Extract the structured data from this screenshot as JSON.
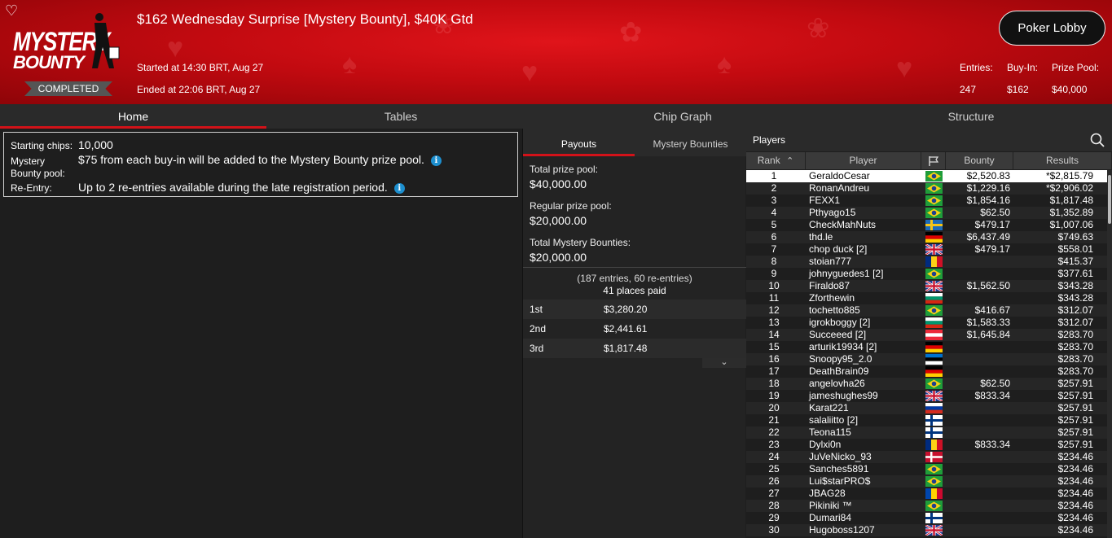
{
  "header": {
    "title": "$162 Wednesday Surprise [Mystery Bounty], $40K Gtd",
    "logo_line1": "MYSTERY",
    "logo_line2": "BOUNTY",
    "status": "COMPLETED",
    "started": "Started at 14:30 BRT, Aug 27",
    "ended": "Ended at 22:06 BRT, Aug 27",
    "lobby_button": "Poker Lobby",
    "stats": [
      {
        "label": "Entries:",
        "value": "247"
      },
      {
        "label": "Buy-In:",
        "value": "$162"
      },
      {
        "label": "Prize Pool:",
        "value": "$40,000"
      }
    ]
  },
  "tabs": [
    "Home",
    "Tables",
    "Chip Graph",
    "Structure"
  ],
  "info": {
    "starting_chips_label": "Starting chips:",
    "starting_chips_value": "10,000",
    "mystery_label_1": "Mystery",
    "mystery_label_2": "Bounty pool:",
    "mystery_value": "$75 from each buy-in will be added to the Mystery Bounty prize pool.",
    "reentry_label": "Re-Entry:",
    "reentry_value": "Up to 2 re-entries available during the late registration period."
  },
  "payouts": {
    "tabs": [
      "Payouts",
      "Mystery Bounties"
    ],
    "total_label": "Total prize pool:",
    "total_value": "$40,000.00",
    "regular_label": "Regular prize pool:",
    "regular_value": "$20,000.00",
    "mystery_label": "Total Mystery Bounties:",
    "mystery_value": "$20,000.00",
    "entries_note": "(187 entries, 60 re-entries)",
    "places_paid": "41 places paid",
    "rows": [
      {
        "place": "1st",
        "amount": "$3,280.20"
      },
      {
        "place": "2nd",
        "amount": "$2,441.61"
      },
      {
        "place": "3rd",
        "amount": "$1,817.48"
      }
    ]
  },
  "players": {
    "title": "Players",
    "columns": {
      "rank": "Rank",
      "player": "Player",
      "bounty": "Bounty",
      "results": "Results"
    },
    "rows": [
      {
        "rank": "1",
        "name": "GeraldoCesar",
        "flag": "br",
        "bounty": "$2,520.83",
        "result": "*$2,815.79"
      },
      {
        "rank": "2",
        "name": "RonanAndreu",
        "flag": "br",
        "bounty": "$1,229.16",
        "result": "*$2,906.02"
      },
      {
        "rank": "3",
        "name": "FEXX1",
        "flag": "br",
        "bounty": "$1,854.16",
        "result": "$1,817.48"
      },
      {
        "rank": "4",
        "name": "Pthyago15",
        "flag": "br",
        "bounty": "$62.50",
        "result": "$1,352.89"
      },
      {
        "rank": "5",
        "name": "CheckMahNuts",
        "flag": "se",
        "bounty": "$479.17",
        "result": "$1,007.06"
      },
      {
        "rank": "6",
        "name": "thd.le",
        "flag": "de",
        "bounty": "$6,437.49",
        "result": "$749.63"
      },
      {
        "rank": "7",
        "name": "chop duck [2]",
        "flag": "gb",
        "bounty": "$479.17",
        "result": "$558.01"
      },
      {
        "rank": "8",
        "name": "stoian777",
        "flag": "ro",
        "bounty": "",
        "result": "$415.37"
      },
      {
        "rank": "9",
        "name": "johnyguedes1 [2]",
        "flag": "br",
        "bounty": "",
        "result": "$377.61"
      },
      {
        "rank": "10",
        "name": "Firaldo87",
        "flag": "gb",
        "bounty": "$1,562.50",
        "result": "$343.28"
      },
      {
        "rank": "11",
        "name": "Zforthewin",
        "flag": "bg",
        "bounty": "",
        "result": "$343.28"
      },
      {
        "rank": "12",
        "name": "tochetto885",
        "flag": "br",
        "bounty": "$416.67",
        "result": "$312.07"
      },
      {
        "rank": "13",
        "name": "igrokboggy [2]",
        "flag": "bg",
        "bounty": "$1,583.33",
        "result": "$312.07"
      },
      {
        "rank": "14",
        "name": "Succeeed [2]",
        "flag": "at",
        "bounty": "$1,645.84",
        "result": "$283.70"
      },
      {
        "rank": "15",
        "name": "arturik19934 [2]",
        "flag": "de",
        "bounty": "",
        "result": "$283.70"
      },
      {
        "rank": "16",
        "name": "Snoopy95_2.0",
        "flag": "ee",
        "bounty": "",
        "result": "$283.70"
      },
      {
        "rank": "17",
        "name": "DeathBrain09",
        "flag": "de",
        "bounty": "",
        "result": "$283.70"
      },
      {
        "rank": "18",
        "name": "angelovha26",
        "flag": "br",
        "bounty": "$62.50",
        "result": "$257.91"
      },
      {
        "rank": "19",
        "name": "jameshughes99",
        "flag": "gb",
        "bounty": "$833.34",
        "result": "$257.91"
      },
      {
        "rank": "20",
        "name": "Karat221",
        "flag": "ru",
        "bounty": "",
        "result": "$257.91"
      },
      {
        "rank": "21",
        "name": "salaliitto [2]",
        "flag": "fi",
        "bounty": "",
        "result": "$257.91"
      },
      {
        "rank": "22",
        "name": "Teona115",
        "flag": "fi",
        "bounty": "",
        "result": "$257.91"
      },
      {
        "rank": "23",
        "name": "Dylxi0n",
        "flag": "ro",
        "bounty": "$833.34",
        "result": "$257.91"
      },
      {
        "rank": "24",
        "name": "JuVeNicko_93",
        "flag": "dk",
        "bounty": "",
        "result": "$234.46"
      },
      {
        "rank": "25",
        "name": "Sanches5891",
        "flag": "br",
        "bounty": "",
        "result": "$234.46"
      },
      {
        "rank": "26",
        "name": "Lui$starPRO$",
        "flag": "br",
        "bounty": "",
        "result": "$234.46"
      },
      {
        "rank": "27",
        "name": "JBAG28",
        "flag": "md",
        "bounty": "",
        "result": "$234.46"
      },
      {
        "rank": "28",
        "name": "Pikiniki ™",
        "flag": "br",
        "bounty": "",
        "result": "$234.46"
      },
      {
        "rank": "29",
        "name": "Dumari84",
        "flag": "fi",
        "bounty": "",
        "result": "$234.46"
      },
      {
        "rank": "30",
        "name": "Hugoboss1207",
        "flag": "gb",
        "bounty": "",
        "result": "$234.46"
      }
    ]
  },
  "colors": {
    "accent": "#d21219",
    "header_red": "#c20a10",
    "info_icon": "#1d8fcf"
  }
}
